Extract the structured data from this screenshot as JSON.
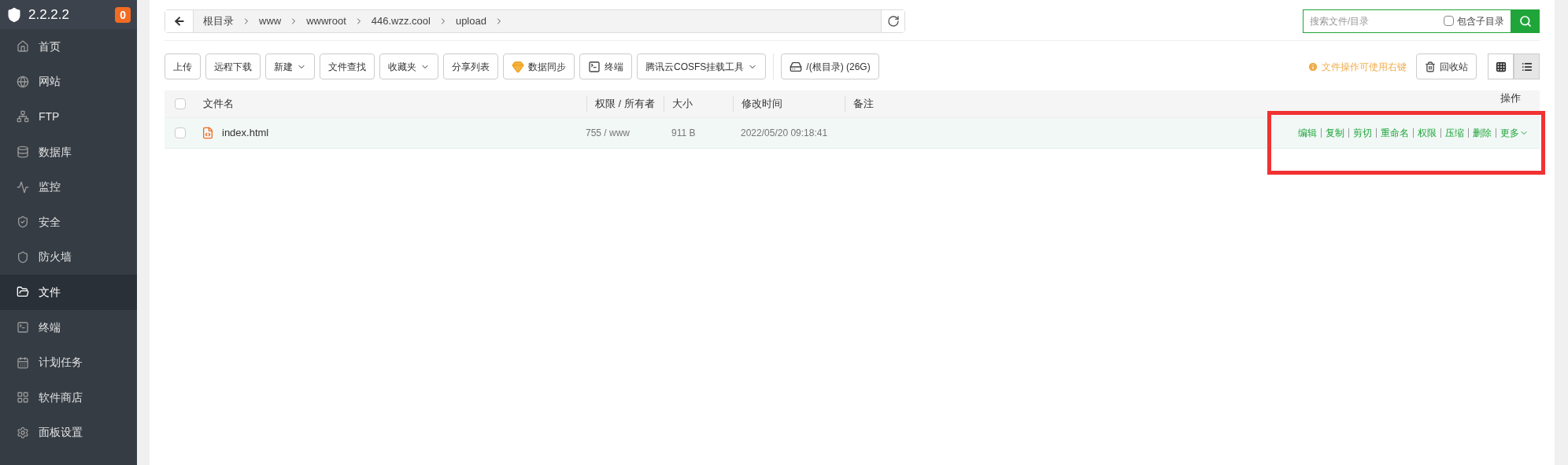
{
  "sidebar": {
    "title": "2.2.2.2",
    "badge": "0",
    "items": [
      {
        "label": "首页",
        "selected": false
      },
      {
        "label": "网站",
        "selected": false
      },
      {
        "label": "FTP",
        "selected": false
      },
      {
        "label": "数据库",
        "selected": false
      },
      {
        "label": "监控",
        "selected": false
      },
      {
        "label": "安全",
        "selected": false
      },
      {
        "label": "防火墙",
        "selected": false
      },
      {
        "label": "文件",
        "selected": true
      },
      {
        "label": "终端",
        "selected": false
      },
      {
        "label": "计划任务",
        "selected": false
      },
      {
        "label": "软件商店",
        "selected": false
      },
      {
        "label": "面板设置",
        "selected": false
      }
    ]
  },
  "breadcrumb": [
    "根目录",
    "www",
    "wwwroot",
    "446.wzz.cool",
    "upload"
  ],
  "search": {
    "placeholder": "搜索文件/目录",
    "subdir_label": "包含子目录",
    "subdir_checked": false
  },
  "toolbar": [
    {
      "label": "上传",
      "kind": "plain"
    },
    {
      "label": "远程下载",
      "kind": "plain"
    },
    {
      "label": "新建",
      "kind": "dropdown"
    },
    {
      "label": "文件查找",
      "kind": "plain"
    },
    {
      "label": "收藏夹",
      "kind": "dropdown"
    },
    {
      "label": "分享列表",
      "kind": "plain"
    },
    {
      "label": "数据同步",
      "kind": "gem"
    },
    {
      "label": "终端",
      "kind": "terminal"
    },
    {
      "label": "腾讯云COSFS挂载工具",
      "kind": "dropdown"
    },
    {
      "label": "/(根目录) (26G)",
      "kind": "disk"
    }
  ],
  "hint": "文件操作可使用右键",
  "recycle_button": "回收站",
  "views": [
    {
      "kind": "grid",
      "selected": false
    },
    {
      "kind": "list",
      "selected": true
    }
  ],
  "table": {
    "select_all_checked": false,
    "columns": [
      "文件名",
      "权限 / 所有者",
      "大小",
      "修改时间",
      "备注",
      "操作"
    ],
    "rows": [
      {
        "checked": false,
        "name": "index.html",
        "permission": "755 / www",
        "size": "911 B",
        "modified": "2022/05/20 09:18:41",
        "actions": [
          "编辑",
          "复制",
          "剪切",
          "重命名",
          "权限",
          "压缩",
          "删除",
          "更多"
        ]
      }
    ]
  }
}
